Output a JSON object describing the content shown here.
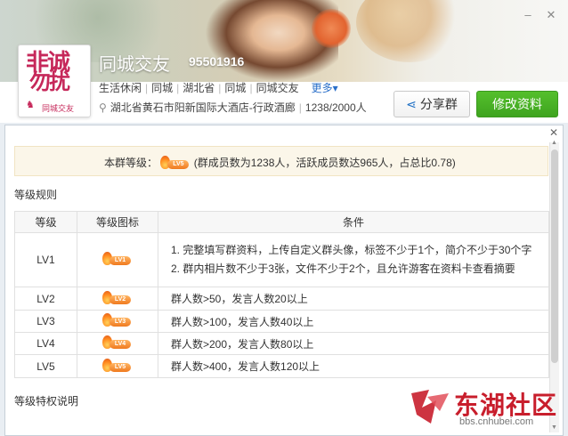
{
  "group": {
    "name": "同城交友",
    "id": "95501916",
    "tags": [
      "生活休闲",
      "同城",
      "湖北省",
      "同城",
      "同城交友"
    ],
    "more_label": "更多",
    "location": "湖北省黄石市阳新国际大酒店-行政酒廊",
    "member_ratio": "1238/2000人",
    "logo_text": [
      "非诚",
      "勿扰"
    ],
    "logo_sub": "同城交友"
  },
  "buttons": {
    "share": "分享群",
    "edit": "修改资料"
  },
  "level_summary": {
    "prefix": "本群等级：",
    "badge": "LV5",
    "detail": "(群成员数为1238人，活跃成员数达965人，占总比0.78)"
  },
  "rules_title": "等级规则",
  "table": {
    "headers": [
      "等级",
      "等级图标",
      "条件"
    ],
    "rows": [
      {
        "level": "LV1",
        "badge": "LV1",
        "conditions": [
          "1. 完整填写群资料，上传自定义群头像，标签不少于1个，简介不少于30个字",
          "2. 群内相片数不少于3张，文件不少于2个，且允许游客在资料卡查看摘要"
        ]
      },
      {
        "level": "LV2",
        "badge": "LV2",
        "conditions": [
          "群人数>50，发言人数20以上"
        ]
      },
      {
        "level": "LV3",
        "badge": "LV3",
        "conditions": [
          "群人数>100，发言人数40以上"
        ]
      },
      {
        "level": "LV4",
        "badge": "LV4",
        "conditions": [
          "群人数>200，发言人数80以上"
        ]
      },
      {
        "level": "LV5",
        "badge": "LV5",
        "conditions": [
          "群人数>400，发言人数120以上"
        ]
      }
    ]
  },
  "privileges_title": "等级特权说明",
  "watermark": {
    "name": "东湖社区",
    "url": "bbs.cnhubei.com"
  },
  "colors": {
    "accent_green": "#42a81f",
    "link_blue": "#2a6fc9",
    "badge_orange": "#f07a1f",
    "watermark_red": "#c81e2c"
  }
}
